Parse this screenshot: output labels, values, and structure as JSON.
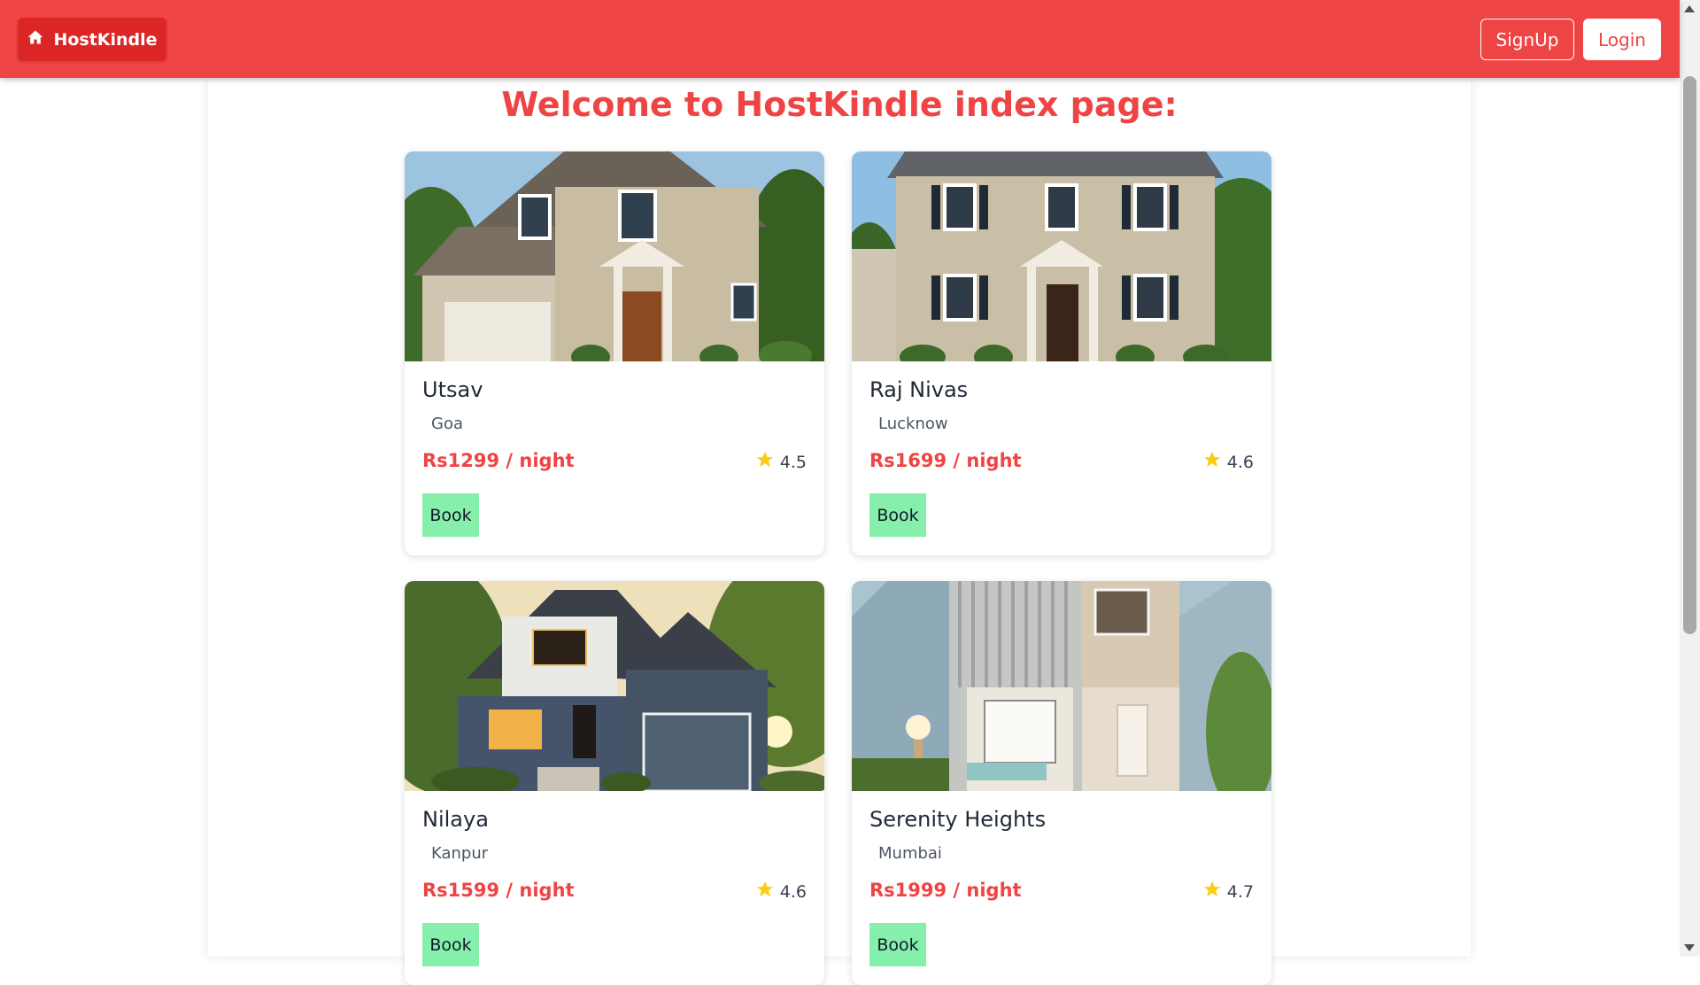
{
  "nav": {
    "brand": "HostKindle",
    "signup": "SignUp",
    "login": "Login"
  },
  "main": {
    "title": "Welcome to HostKindle index page:"
  },
  "listings": [
    {
      "title": "Utsav",
      "location": "Goa",
      "price": "Rs1299 / night",
      "rating": "4.5",
      "book": "Book"
    },
    {
      "title": "Raj Nivas",
      "location": "Lucknow",
      "price": "Rs1699 / night",
      "rating": "4.6",
      "book": "Book"
    },
    {
      "title": "Nilaya",
      "location": "Kanpur",
      "price": "Rs1599 / night",
      "rating": "4.6",
      "book": "Book"
    },
    {
      "title": "Serenity Heights",
      "location": "Mumbai",
      "price": "Rs1999 / night",
      "rating": "4.7",
      "book": "Book"
    }
  ],
  "colors": {
    "accent": "#ef4444",
    "brand_bg": "#dc2626",
    "book_button": "#86efac",
    "star": "#facc15"
  },
  "icons": {
    "brand": "home-icon",
    "rating": "star-icon"
  }
}
